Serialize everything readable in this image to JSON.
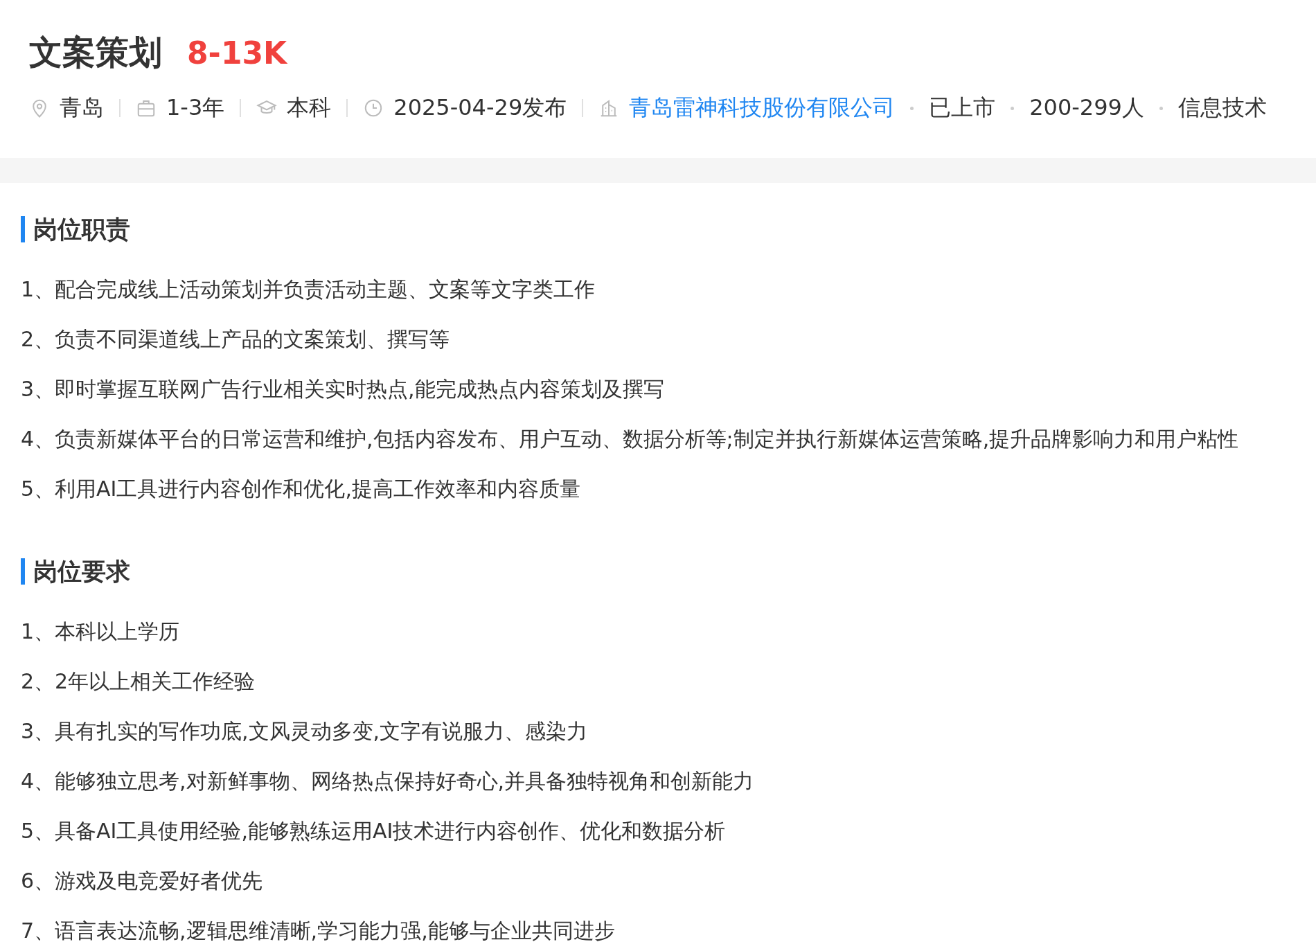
{
  "job": {
    "title": "文案策划",
    "salary": "8-13K"
  },
  "meta": [
    {
      "kind": "location",
      "text": "青岛"
    },
    {
      "kind": "experience",
      "text": "1-3年"
    },
    {
      "kind": "education",
      "text": "本科"
    },
    {
      "kind": "time",
      "text": "2025-04-29发布"
    }
  ],
  "company": {
    "name": "青岛雷神科技股份有限公司",
    "tags": [
      "已上市",
      "200-299人",
      "信息技术"
    ]
  },
  "sections": [
    {
      "heading": "岗位职责",
      "items": [
        "1、配合完成线上活动策划并负责活动主题、文案等文字类工作",
        "2、负责不同渠道线上产品的文案策划、撰写等",
        "3、即时掌握互联网广告行业相关实时热点,能完成热点内容策划及撰写",
        "4、负责新媒体平台的日常运营和维护,包括内容发布、用户互动、数据分析等;制定并执行新媒体运营策略,提升品牌影响力和用户粘性",
        "5、利用AI工具进行内容创作和优化,提高工作效率和内容质量"
      ]
    },
    {
      "heading": "岗位要求",
      "items": [
        "1、本科以上学历",
        "2、2年以上相关工作经验",
        "3、具有扎实的写作功底,文风灵动多变,文字有说服力、感染力",
        "4、能够独立思考,对新鲜事物、网络热点保持好奇心,并具备独特视角和创新能力",
        "5、具备AI工具使用经验,能够熟练运用AI技术进行内容创作、优化和数据分析",
        "6、游戏及电竞爱好者优先",
        "7、语言表达流畅,逻辑思维清晰,学习能力强,能够与企业共同进步"
      ]
    }
  ]
}
